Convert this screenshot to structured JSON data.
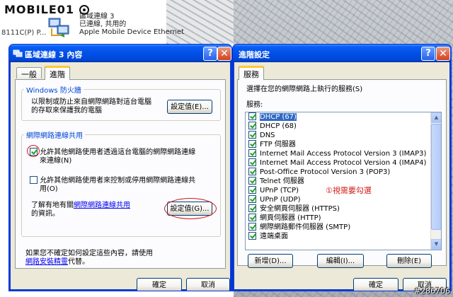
{
  "background": {
    "logo": "MOBILE01",
    "logo_sub": "",
    "connection": {
      "name": "區域連線 3",
      "status": "已連線, 共用的",
      "device": "Apple Mobile Device Ethernet"
    },
    "left_partial": "8111C(P) P...",
    "watermark": "#286706"
  },
  "props_window": {
    "title": "區域連線 3 內容",
    "help_btn": "?",
    "close_btn": "✕",
    "tabs": [
      "一般",
      "進階"
    ],
    "active_tab": "進階",
    "firewall": {
      "legend": "Windows 防火牆",
      "description_1": "以限制或防止來自網際網路對這台電腦",
      "description_2": "的存取來保護我的電腦",
      "settings_btn": "設定值(E)..."
    },
    "ics": {
      "legend": "網際網路連線共用",
      "allow_connect_1": "允許其他網路使用者透過這台電腦的網際網路連線",
      "allow_connect_2": "來連線(N)",
      "allow_connect_checked": true,
      "allow_control_1": "允許其他網路使用者來控制或停用網際網路連線共",
      "allow_control_2": "用(O)",
      "allow_control_checked": false,
      "learn_prefix": "了解有地有關",
      "learn_link": "網際網路連線共用",
      "learn_suffix": "的資訊。",
      "settings_btn": "設定值(G)..."
    },
    "footer_1": "如果您不確定如何設定這些內容，請使用",
    "footer_link": "網路安裝精靈",
    "footer_2": "代替。",
    "ok_btn": "確定",
    "cancel_btn": "取消"
  },
  "adv_window": {
    "title": "進階設定",
    "help_btn": "?",
    "close_btn": "✕",
    "tab": "服務",
    "intro": "選擇在您的網際網路上執行的服務(S)",
    "services_label": "服務:",
    "services": [
      {
        "label": "DHCP (67)",
        "checked": true,
        "selected": true
      },
      {
        "label": "DHCP (68)",
        "checked": true,
        "selected": false
      },
      {
        "label": "DNS",
        "checked": true,
        "selected": false
      },
      {
        "label": "FTP 伺服器",
        "checked": true,
        "selected": false
      },
      {
        "label": "Internet Mail Access Protocol Version 3 (IMAP3)",
        "checked": true,
        "selected": false
      },
      {
        "label": "Internet Mail Access Protocol Version 4 (IMAP4)",
        "checked": true,
        "selected": false
      },
      {
        "label": "Post-Office Protocol Version 3 (POP3)",
        "checked": true,
        "selected": false
      },
      {
        "label": "Telnet 伺服器",
        "checked": true,
        "selected": false
      },
      {
        "label": "UPnP (TCP)",
        "checked": true,
        "selected": false
      },
      {
        "label": "UPnP (UDP)",
        "checked": true,
        "selected": false
      },
      {
        "label": "安全網頁伺服器 (HTTPS)",
        "checked": true,
        "selected": false
      },
      {
        "label": "網頁伺服器 (HTTP)",
        "checked": true,
        "selected": false
      },
      {
        "label": "網際網路郵件伺服器 (SMTP)",
        "checked": true,
        "selected": false
      },
      {
        "label": "遠端桌面",
        "checked": true,
        "selected": false
      }
    ],
    "annotation": "①視需要勾選",
    "add_btn": "新增(D)...",
    "edit_btn": "編輯(I)...",
    "delete_btn": "刪除(E)",
    "ok_btn": "確定",
    "cancel_btn": "取消"
  },
  "colors": {
    "titlebar": "#0050e6",
    "dialog_bg": "#ece9d8",
    "selection": "#316ac5",
    "annotation": "#d01818",
    "group_legend": "#0046d5"
  }
}
